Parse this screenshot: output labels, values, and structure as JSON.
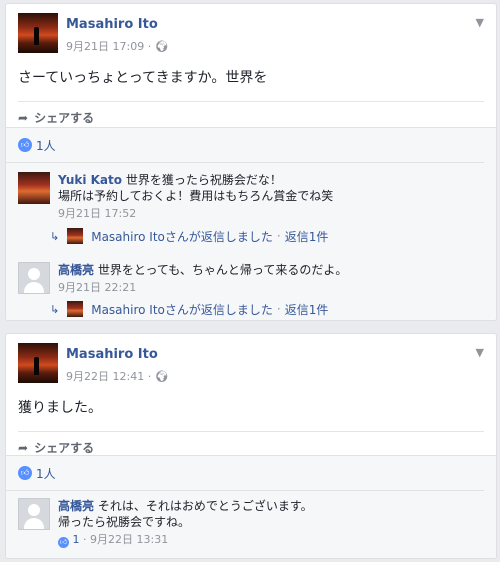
{
  "posts": [
    {
      "author": "Masahiro Ito",
      "timestamp": "9月21日 17:09",
      "audience_icon": "globe-icon",
      "message": "さーていっちょとってきますか。世界を",
      "share_label": "シェアする",
      "likes": "1人",
      "comments": [
        {
          "author": "Yuki Kato",
          "text_line1": "世界を獲ったら祝勝会だな！",
          "text_line2": "場所は予約しておくよ！費用はもちろん賞金でね笑",
          "timestamp": "9月21日 17:52",
          "reply_text": "Masahiro Itoさんが返信しました",
          "reply_count": "返信1件"
        },
        {
          "author": "高橋亮",
          "text_line1": "世界をとっても、ちゃんと帰って来るのだよ。",
          "timestamp": "9月21日 22:21",
          "reply_text": "Masahiro Itoさんが返信しました",
          "reply_count": "返信1件"
        }
      ]
    },
    {
      "author": "Masahiro Ito",
      "timestamp": "9月22日 12:41",
      "audience_icon": "globe-icon",
      "message": "獲りました。",
      "share_label": "シェアする",
      "likes": "1人",
      "comments": [
        {
          "author": "高橋亮",
          "text_line1": "それは、それはおめでとうございます。",
          "text_line2": "帰ったら祝勝会ですね。",
          "like_count": "1",
          "timestamp": "9月22日 13:31"
        }
      ]
    }
  ]
}
